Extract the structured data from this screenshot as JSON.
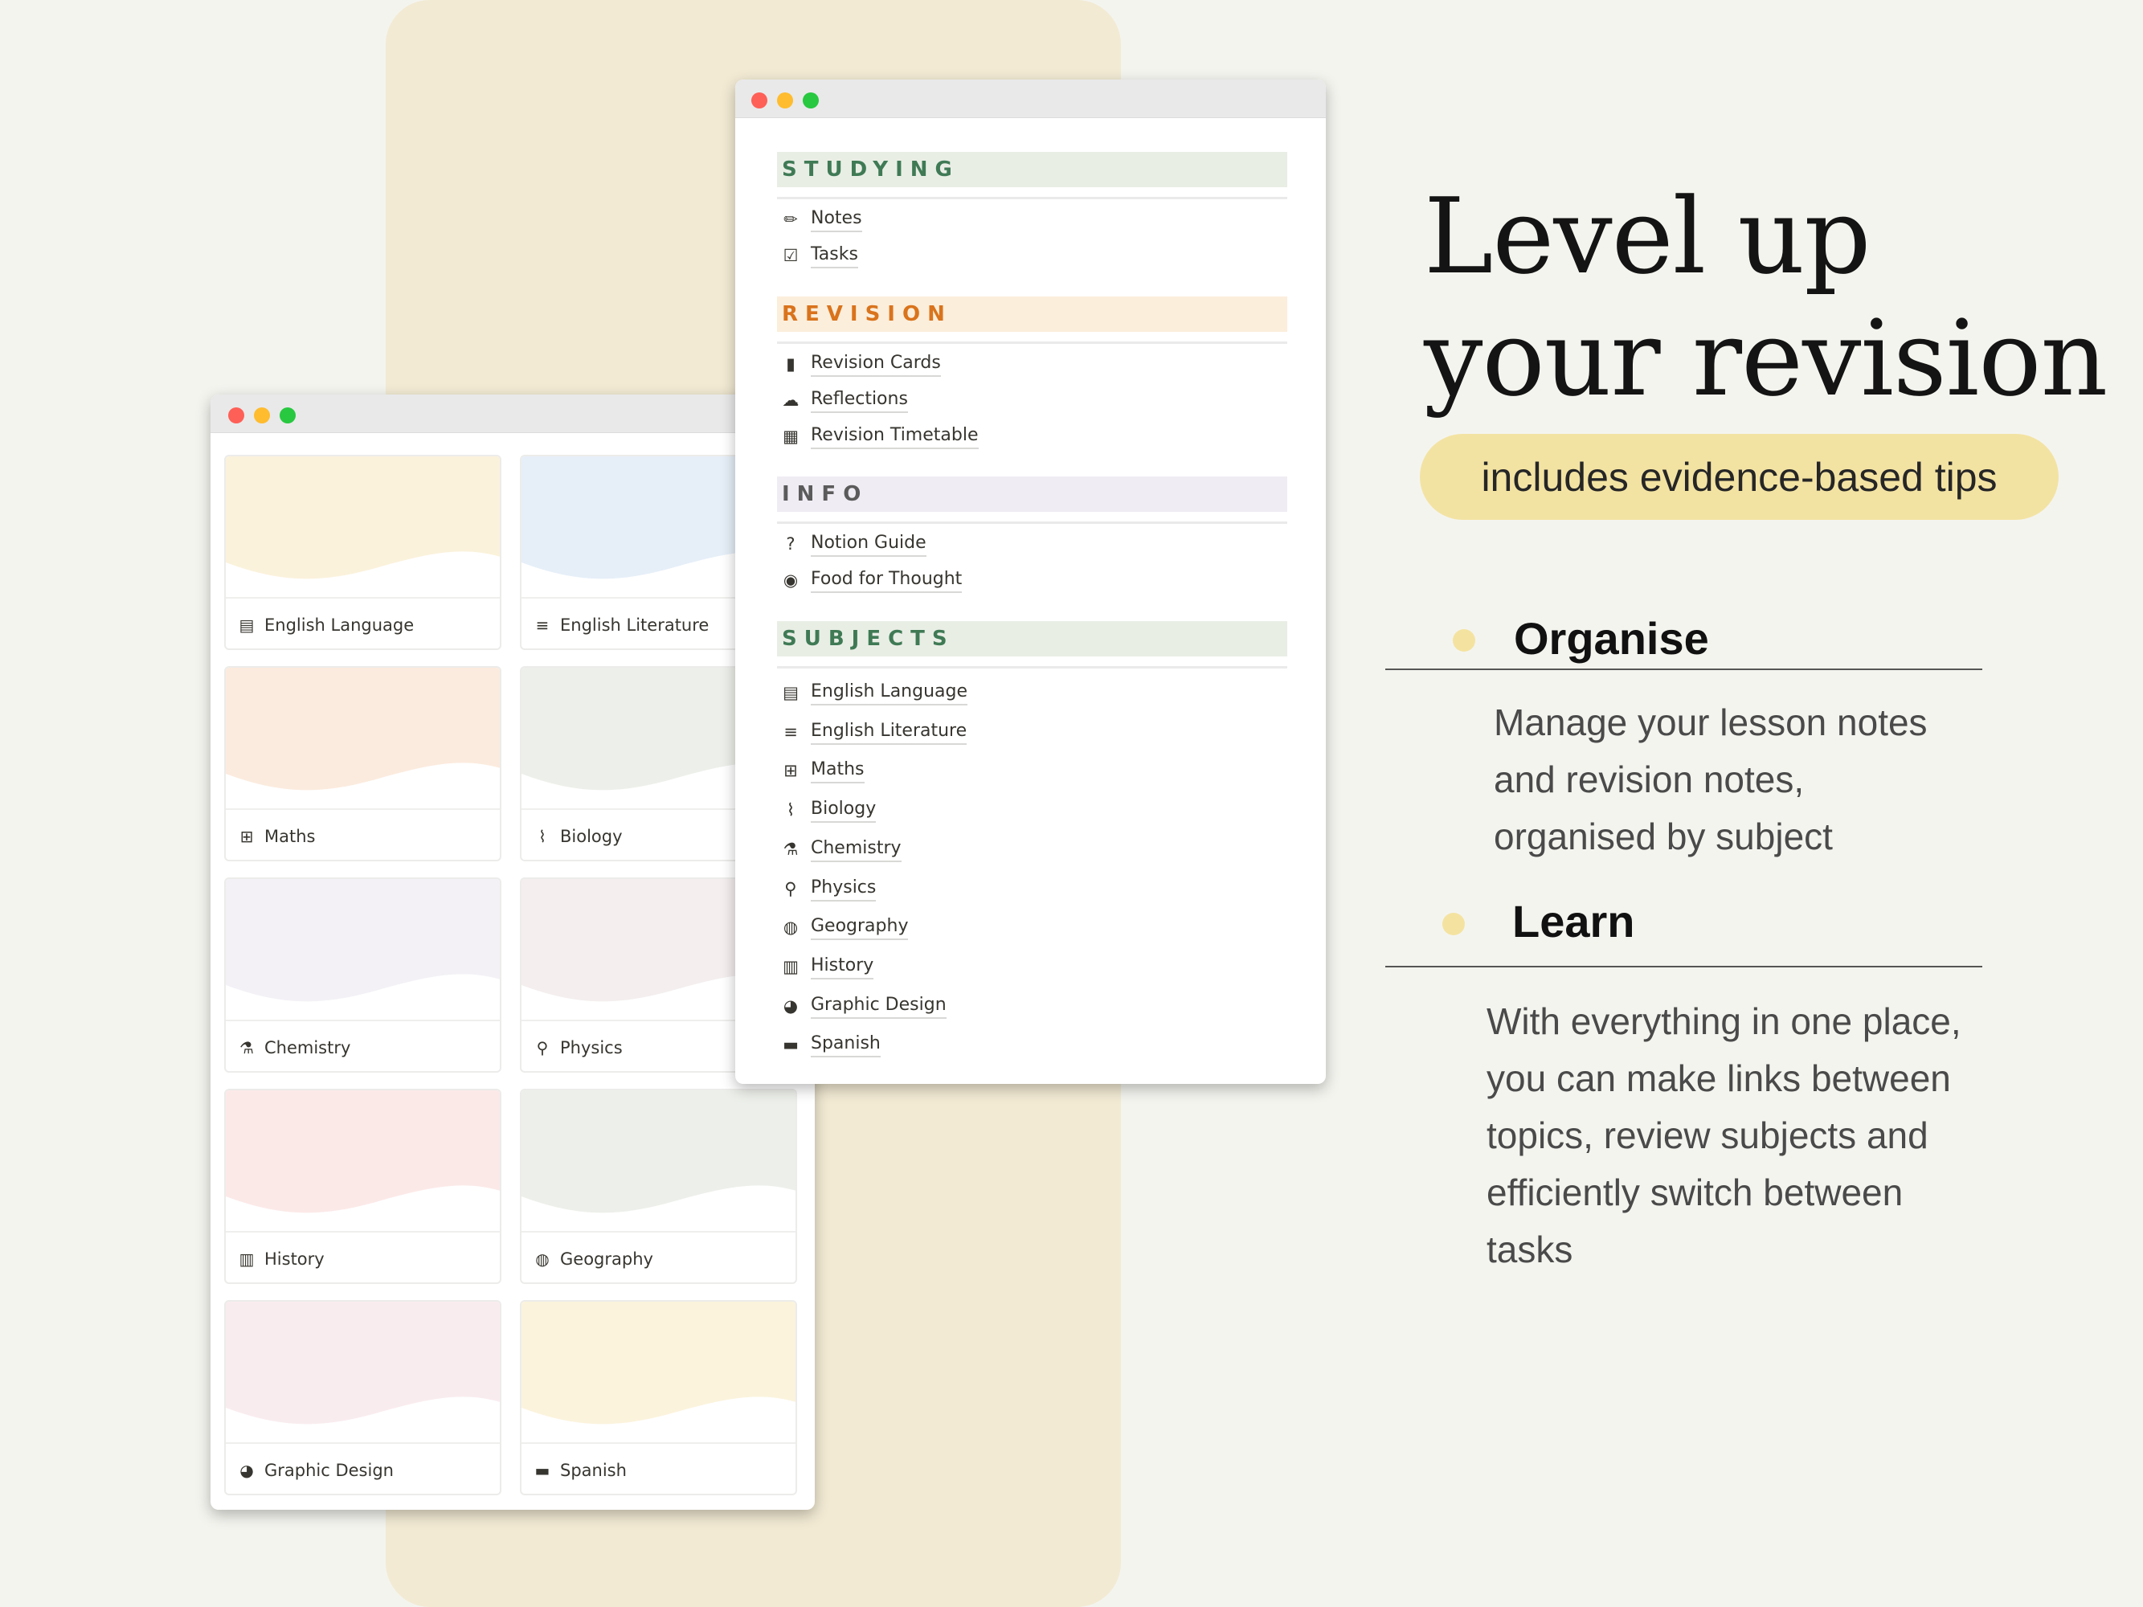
{
  "menu_sections": [
    {
      "title": "STUDYING",
      "color": "#3f7a55",
      "bg": "#e9eee5",
      "items": [
        {
          "icon": "pencil-icon",
          "glyph": "✏",
          "label": "Notes"
        },
        {
          "icon": "checkbox-icon",
          "glyph": "☑",
          "label": "Tasks"
        }
      ]
    },
    {
      "title": "REVISION",
      "color": "#d9731c",
      "bg": "#fbeedb",
      "items": [
        {
          "icon": "bookmark-icon",
          "glyph": "▮",
          "label": "Revision Cards"
        },
        {
          "icon": "cloud-icon",
          "glyph": "☁",
          "label": "Reflections"
        },
        {
          "icon": "calendar-icon",
          "glyph": "▦",
          "label": "Revision Timetable"
        }
      ]
    },
    {
      "title": "INFO",
      "color": "#5b5b5b",
      "bg": "#efecf3",
      "items": [
        {
          "icon": "question-icon",
          "glyph": "?",
          "label": "Notion Guide"
        },
        {
          "icon": "food-icon",
          "glyph": "◉",
          "label": "Food for Thought"
        }
      ]
    },
    {
      "title": "SUBJECTS",
      "color": "#3f7a55",
      "bg": "#e9eee5",
      "items": [
        {
          "icon": "notebook-icon",
          "glyph": "▤",
          "label": "English Language"
        },
        {
          "icon": "books-icon",
          "glyph": "≡",
          "label": "English Literature"
        },
        {
          "icon": "abacus-icon",
          "glyph": "⊞",
          "label": "Maths"
        },
        {
          "icon": "dna-icon",
          "glyph": "⌇",
          "label": "Biology"
        },
        {
          "icon": "test-tube-icon",
          "glyph": "⚗",
          "label": "Chemistry"
        },
        {
          "icon": "telescope-icon",
          "glyph": "⚲",
          "label": "Physics"
        },
        {
          "icon": "globe-icon",
          "glyph": "◍",
          "label": "Geography"
        },
        {
          "icon": "scroll-icon",
          "glyph": "▥",
          "label": "History"
        },
        {
          "icon": "palette-icon",
          "glyph": "◕",
          "label": "Graphic Design"
        },
        {
          "icon": "spain-flag-icon",
          "glyph": "▬",
          "label": "Spanish"
        }
      ]
    }
  ],
  "gallery_cards": [
    {
      "label": "English Language",
      "icon": "notebook-icon",
      "glyph": "▤",
      "color": "#fbf2dc"
    },
    {
      "label": "English Literature",
      "icon": "books-icon",
      "glyph": "≡",
      "color": "#e6eff8"
    },
    {
      "label": "Maths",
      "icon": "abacus-icon",
      "glyph": "⊞",
      "color": "#fbebde"
    },
    {
      "label": "Biology",
      "icon": "dna-icon",
      "glyph": "⌇",
      "color": "#edf0ea"
    },
    {
      "label": "Chemistry",
      "icon": "test-tube-icon",
      "glyph": "⚗",
      "color": "#f3f1f6"
    },
    {
      "label": "Physics",
      "icon": "telescope-icon",
      "glyph": "⚲",
      "color": "#f4eeee"
    },
    {
      "label": "History",
      "icon": "scroll-icon",
      "glyph": "▥",
      "color": "#fbe9e8"
    },
    {
      "label": "Geography",
      "icon": "globe-icon",
      "glyph": "◍",
      "color": "#edf0ea"
    },
    {
      "label": "Graphic Design",
      "icon": "palette-icon",
      "glyph": "◕",
      "color": "#f9ecef"
    },
    {
      "label": "Spanish",
      "icon": "spain-flag-icon",
      "glyph": "▬",
      "color": "#fbf3dc"
    }
  ],
  "headline": {
    "line1": "Level up",
    "line2": "your revision"
  },
  "pill": "includes evidence-based tips",
  "features": [
    {
      "title": "Organise",
      "body": "Manage your lesson notes\nand revision notes,\norganised by subject"
    },
    {
      "title": "Learn",
      "body": "With everything in one place,\nyou can make links between\ntopics, review subjects and\nefficiently switch between\ntasks"
    }
  ],
  "colors": {
    "accent_yellow": "#f3e3a3",
    "background": "#f4f4ef",
    "pillar": "#f2ead3"
  }
}
